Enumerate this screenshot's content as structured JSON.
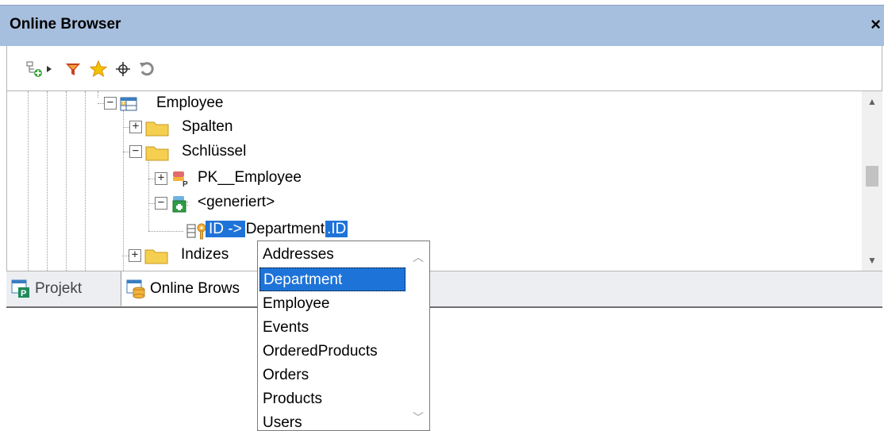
{
  "window": {
    "title": "Online Browser",
    "close_glyph": "×"
  },
  "toolbar": {
    "buttons": [
      {
        "name": "add-object-icon"
      },
      {
        "name": "dropdown-arrow-icon"
      },
      {
        "name": "filter-icon"
      },
      {
        "name": "favorites-star-icon"
      },
      {
        "name": "locate-crosshair-icon"
      },
      {
        "name": "refresh-icon"
      }
    ]
  },
  "tree": {
    "employee": "Employee",
    "spalten": "Spalten",
    "schluessel": "Schlüssel",
    "pk_employee": "PK__Employee",
    "generiert": "<generiert>",
    "relation_left": "ID ->",
    "relation_table": "Department",
    "relation_right": ".ID",
    "indizes": "Indizes"
  },
  "tabs": [
    {
      "label": "Projekt"
    },
    {
      "label": "Online Brows"
    }
  ],
  "dropdown": {
    "items": [
      "Addresses",
      "Department",
      "Employee",
      "Events",
      "OrderedProducts",
      "Orders",
      "Products",
      "Users"
    ],
    "selected": "Department"
  },
  "colors": {
    "titlebar": "#a7bfde",
    "selection": "#1e73d8",
    "folder": "#f5cf4f"
  }
}
